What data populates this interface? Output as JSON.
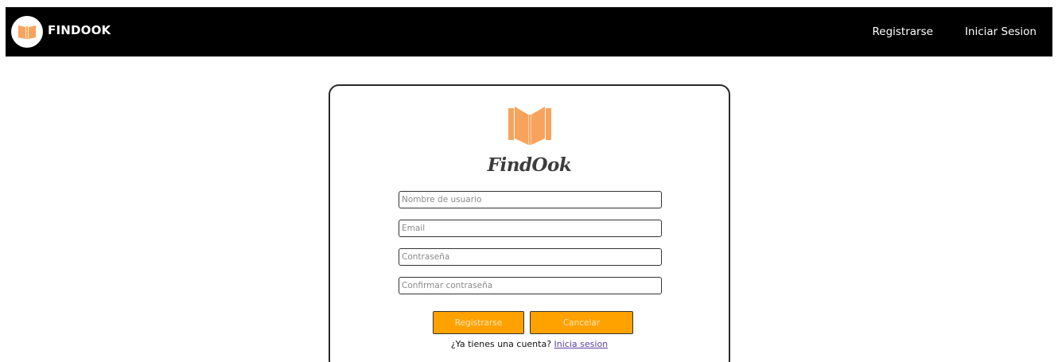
{
  "navbar": {
    "brand_name": "FINDOOK",
    "logo_icon": "book-icon",
    "links": [
      "Registrarse",
      "Iniciar Sesion"
    ],
    "background": "#000000"
  },
  "form": {
    "logo_icon": "open-book-icon",
    "title": "FindOok",
    "fields": {
      "username_placeholder": "Nombre de usuario",
      "email_placeholder": "Email",
      "password_placeholder": "Contraseña",
      "confirm_placeholder": "Confirmar contraseña"
    },
    "buttons": {
      "register": "Registrarse",
      "cancel": "Cancelar"
    },
    "login_prompt": "¿Ya tienes una cuenta?",
    "login_link": "Inicia sesion",
    "accent_color": "#ffa200",
    "logo_color": "#f7a35c"
  }
}
